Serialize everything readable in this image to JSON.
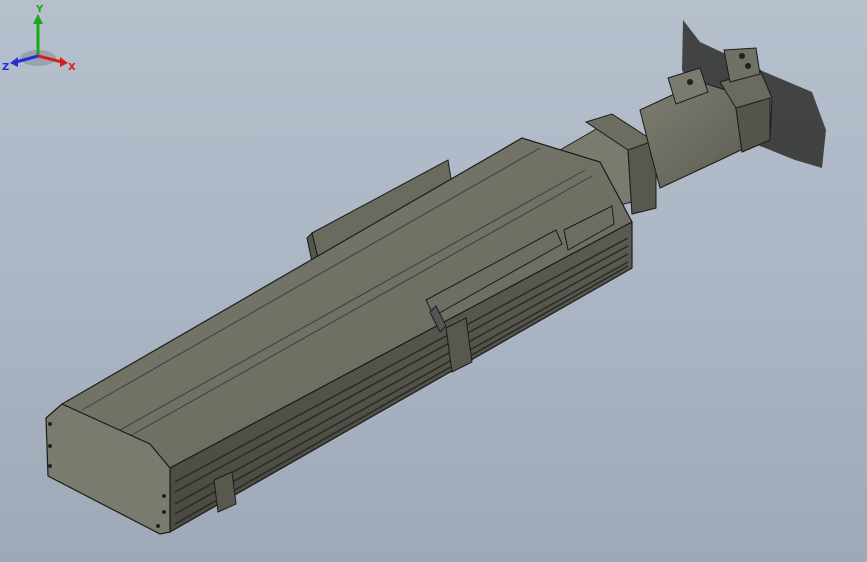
{
  "view": {
    "background_top": "#b6c0cd",
    "background_bottom": "#9ea9b8",
    "model_color": "#6f6f63",
    "edge_color": "#1c1c1a"
  },
  "triad": {
    "x_label": "X",
    "y_label": "Y",
    "z_label": "Z",
    "x_color": "#d22020",
    "y_color": "#1aa81a",
    "z_color": "#2030d8"
  }
}
